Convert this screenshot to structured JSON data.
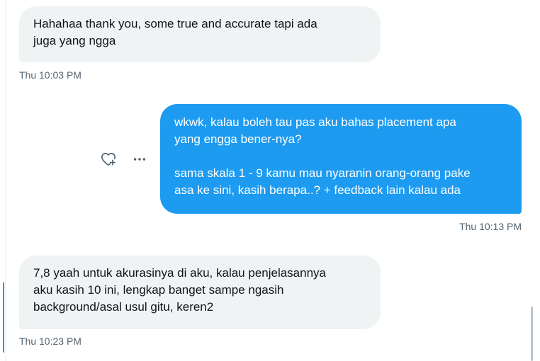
{
  "conversation": {
    "messages": [
      {
        "direction": "received",
        "text": "Hahahaa thank you, some true and accurate tapi ada\njuga yang ngga",
        "timestamp": "Thu 10:03 PM"
      },
      {
        "direction": "sent",
        "text": "wkwk, kalau boleh tau pas aku bahas placement apa\nyang engga bener-nya?\n\nsama skala 1 - 9 kamu mau nyaranin orang-orang pake\nasa ke sini, kasih berapa..? + feedback lain kalau ada",
        "timestamp": "Thu 10:13 PM"
      },
      {
        "direction": "received",
        "text": "7,8 yaah untuk akurasinya di aku, kalau penjelasannya\naku kasih 10 ini, lengkap banget sampe ngasih\nbackground/asal usul gitu, keren2",
        "timestamp": "Thu 10:23 PM"
      }
    ],
    "hover_actions": {
      "react_icon": "heart-plus-icon",
      "more_icon": "more-horizontal-icon"
    }
  },
  "colors": {
    "accent": "#1d9bf0",
    "received_bubble": "#eff3f4",
    "timestamp_text": "#536471",
    "body_text": "#0f1419"
  }
}
